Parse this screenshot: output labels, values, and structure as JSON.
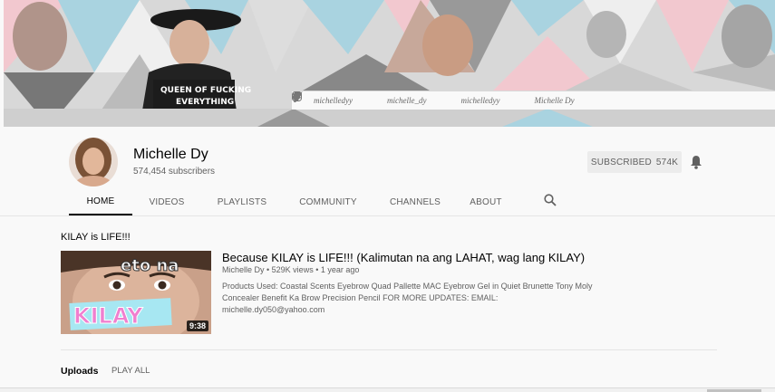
{
  "banner": {
    "shirt_text": "QUEEN OF FUCKING EVERYTHING",
    "socials": [
      {
        "icon": "instagram-icon",
        "handle": "michelledyy"
      },
      {
        "icon": "twitter-icon",
        "handle": "michelle_dy"
      },
      {
        "icon": "snapchat-icon",
        "handle": "michelledyy"
      },
      {
        "icon": "facebook-icon",
        "handle": "Michelle Dy"
      }
    ]
  },
  "channel": {
    "name": "Michelle Dy",
    "subscribers": "574,454 subscribers",
    "subscribe_label": "SUBSCRIBED",
    "subscribe_count": "574K",
    "bell_icon": "bell-icon"
  },
  "tabs": [
    {
      "label": "HOME",
      "active": true
    },
    {
      "label": "VIDEOS",
      "active": false
    },
    {
      "label": "PLAYLISTS",
      "active": false
    },
    {
      "label": "COMMUNITY",
      "active": false
    },
    {
      "label": "CHANNELS",
      "active": false
    },
    {
      "label": "ABOUT",
      "active": false
    }
  ],
  "featured": {
    "section_title": "KILAY is LIFE!!!",
    "thumb_text_top": "eto na",
    "thumb_text_bottom": "KILAY",
    "duration": "9:38",
    "title": "Because KILAY is LIFE!!! (Kalimutan na ang LAHAT, wag lang KILAY)",
    "meta": "Michelle Dy • 529K views • 1 year ago",
    "description": "Products Used: Coastal Scents Eyebrow Quad Pallette MAC Eyebrow Gel in Quiet Brunette Tony Moly Concealer Benefit Ka Brow Precision Pencil FOR MORE UPDATES: EMAIL: michelle.dy050@yahoo.com"
  },
  "uploads": {
    "label": "Uploads",
    "play_all": "PLAY ALL"
  },
  "colors": {
    "banner_blue": "#a9d3e0",
    "banner_pink": "#f2c8cf",
    "accent_text": "#030303",
    "muted_text": "#606060"
  }
}
